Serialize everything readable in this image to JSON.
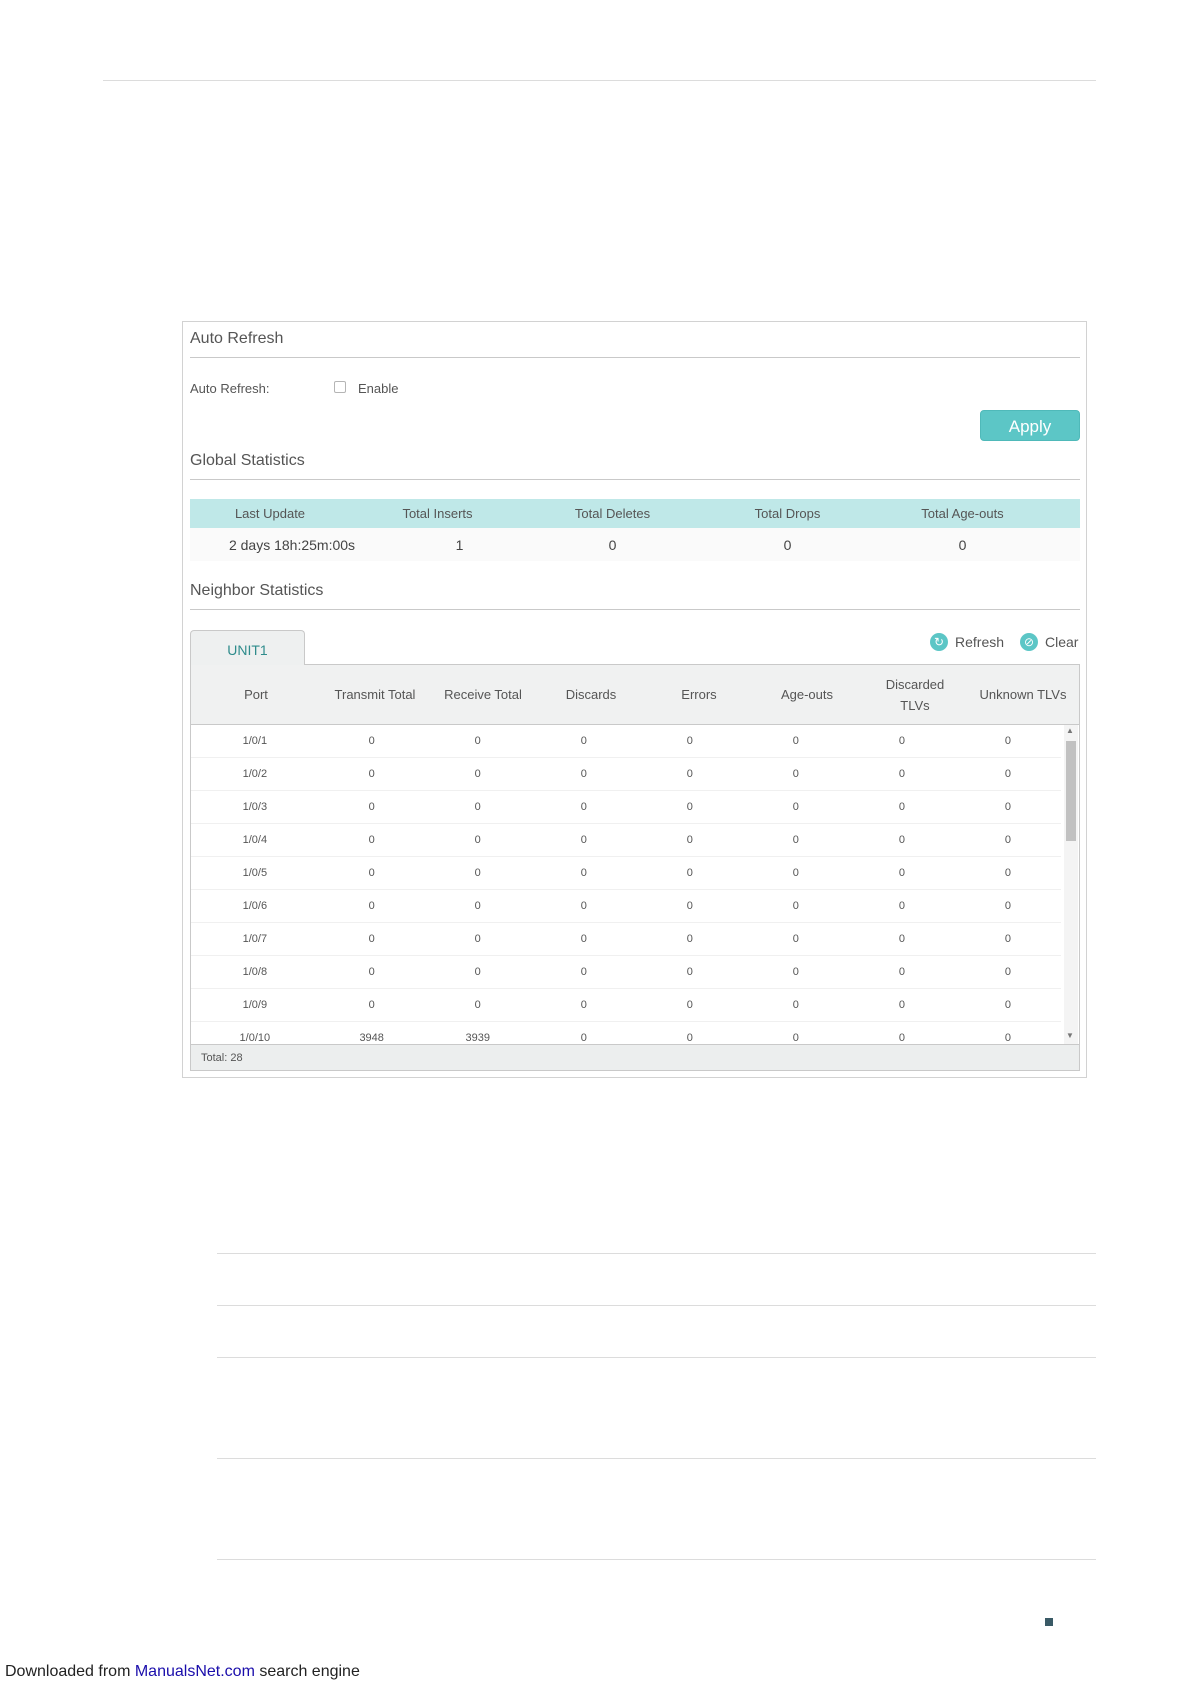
{
  "auto_refresh": {
    "title": "Auto Refresh",
    "label": "Auto Refresh:",
    "checkbox_label": "Enable",
    "checked": false,
    "apply_label": "Apply"
  },
  "global_stats": {
    "title": "Global Statistics",
    "headers": [
      "Last Update",
      "Total Inserts",
      "Total Deletes",
      "Total Drops",
      "Total Age-outs"
    ],
    "values": [
      "2 days 18h:25m:00s",
      "1",
      "0",
      "0",
      "0"
    ]
  },
  "neighbor_stats": {
    "title": "Neighbor Statistics",
    "tab_label": "UNIT1",
    "refresh_label": "Refresh",
    "clear_label": "Clear",
    "headers": [
      "Port",
      "Transmit Total",
      "Receive Total",
      "Discards",
      "Errors",
      "Age-outs",
      "Discarded TLVs",
      "Unknown TLVs"
    ],
    "rows": [
      [
        "1/0/1",
        "0",
        "0",
        "0",
        "0",
        "0",
        "0",
        "0"
      ],
      [
        "1/0/2",
        "0",
        "0",
        "0",
        "0",
        "0",
        "0",
        "0"
      ],
      [
        "1/0/3",
        "0",
        "0",
        "0",
        "0",
        "0",
        "0",
        "0"
      ],
      [
        "1/0/4",
        "0",
        "0",
        "0",
        "0",
        "0",
        "0",
        "0"
      ],
      [
        "1/0/5",
        "0",
        "0",
        "0",
        "0",
        "0",
        "0",
        "0"
      ],
      [
        "1/0/6",
        "0",
        "0",
        "0",
        "0",
        "0",
        "0",
        "0"
      ],
      [
        "1/0/7",
        "0",
        "0",
        "0",
        "0",
        "0",
        "0",
        "0"
      ],
      [
        "1/0/8",
        "0",
        "0",
        "0",
        "0",
        "0",
        "0",
        "0"
      ],
      [
        "1/0/9",
        "0",
        "0",
        "0",
        "0",
        "0",
        "0",
        "0"
      ],
      [
        "1/0/10",
        "3948",
        "3939",
        "0",
        "0",
        "0",
        "0",
        "0"
      ]
    ],
    "total_label": "Total: 28"
  },
  "footer": {
    "prefix": "Downloaded from ",
    "link_text": "ManualsNet.com",
    "suffix": " search engine"
  },
  "colors": {
    "accent": "#5cc6c6",
    "table_header_accent": "#bfe8e8",
    "link": "#1a0dab"
  },
  "icons": {
    "refresh": "refresh-icon",
    "clear": "clear-icon"
  }
}
